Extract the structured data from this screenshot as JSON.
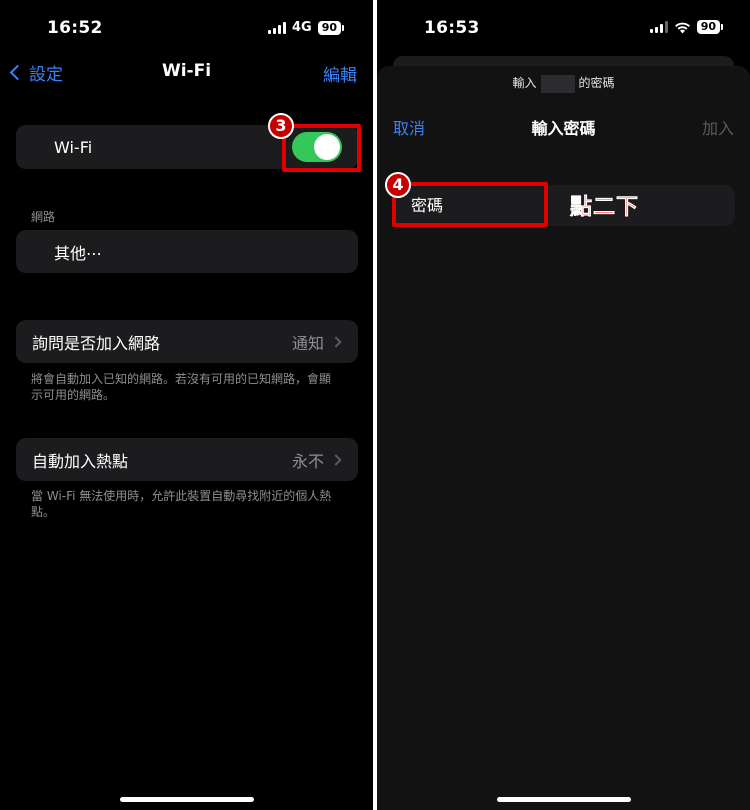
{
  "left": {
    "status": {
      "time": "16:52",
      "network": "4G",
      "battery": "90"
    },
    "nav": {
      "back_label": "設定",
      "title": "Wi-Fi",
      "edit_label": "編輯"
    },
    "wifi_row": {
      "label": "Wi-Fi",
      "enabled": true
    },
    "networks": {
      "header": "網路",
      "other_label": "其他⋯"
    },
    "ask_to_join": {
      "label": "詢問是否加入網路",
      "value": "通知",
      "footnote": "將會自動加入已知的網路。若沒有可用的已知網路，會顯示可用的網路。"
    },
    "auto_join_hotspot": {
      "label": "自動加入熱點",
      "value": "永不",
      "footnote": "當 Wi-Fi 無法使用時，允許此裝置自動尋找附近的個人熱點。"
    },
    "step_badge": "3"
  },
  "right": {
    "status": {
      "time": "16:53",
      "battery": "90"
    },
    "sheet": {
      "prompt_prefix": "輸入",
      "prompt_suffix": "的密碼",
      "cancel_label": "取消",
      "title": "輸入密碼",
      "join_label": "加入",
      "password_placeholder": "密碼"
    },
    "step_badge": "4",
    "annotation": "點二下"
  },
  "colors": {
    "accent": "#3a82f7",
    "toggle_on": "#34c759",
    "highlight": "#e00000"
  }
}
